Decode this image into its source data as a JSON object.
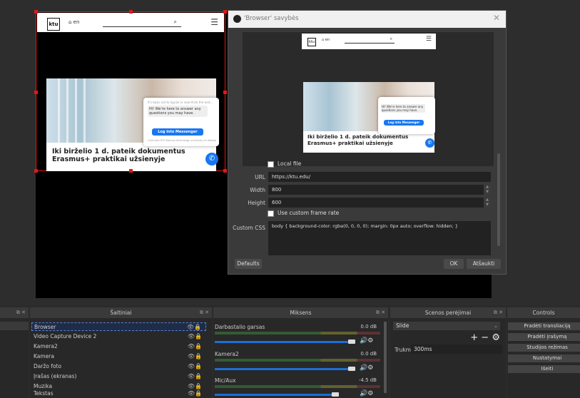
{
  "preview_page": {
    "logo": "ktu",
    "lang": "en",
    "headline": "Iki birželio 1 d. pateik dokumentus Erasmus+ praktikai užsienyje",
    "chat_note": "It's basis not to log be or now think the and...",
    "chat_msg": "Hi! We're here to answer any questions you may have.",
    "chat_button": "Log into Messenger",
    "chat_footer": "Chat with KTU Kaunas technology university on Messenger"
  },
  "dialog": {
    "title": "'Browser' savybės",
    "local_file_label": "Local file",
    "url_label": "URL",
    "url_value": "https://ktu.edu/",
    "width_label": "Width",
    "width_value": "800",
    "height_label": "Height",
    "height_value": "600",
    "custom_fps_label": "Use custom frame rate",
    "css_label": "Custom CSS",
    "css_value": "body { background-color: rgba(0, 0, 0, 0); margin: 0px auto; overflow: hidden; }",
    "defaults_button": "Defaults",
    "ok_button": "OK",
    "cancel_button": "Atšaukti"
  },
  "docks": {
    "sources_title": "Šaltiniai",
    "mixer_title": "Miksens",
    "transitions_title": "Scenos perėjimai",
    "controls_title": "Controls",
    "sources": [
      "Browser",
      "Video Capture Device 2",
      "Kamera2",
      "Kamera",
      "Daržo foto",
      "Įrašas (ekranas)",
      "Muzika",
      "Tekstas"
    ],
    "mixer": [
      {
        "name": "Darbastalio garsas",
        "db": "0.0 dB"
      },
      {
        "name": "Kamera2",
        "db": "0.0 dB"
      },
      {
        "name": "Mic/Aux",
        "db": "-4.5 dB"
      }
    ],
    "transition_value": "Slide",
    "duration_label": "Trukmė",
    "duration_value": "300ms",
    "control_buttons": [
      "Pradėti transliaciją",
      "Pradėti įrašymą",
      "Studijos režimas",
      "Nustatymai",
      "Išeiti"
    ]
  },
  "colors": {
    "selection": "#e01818",
    "accent": "#1877f2"
  }
}
